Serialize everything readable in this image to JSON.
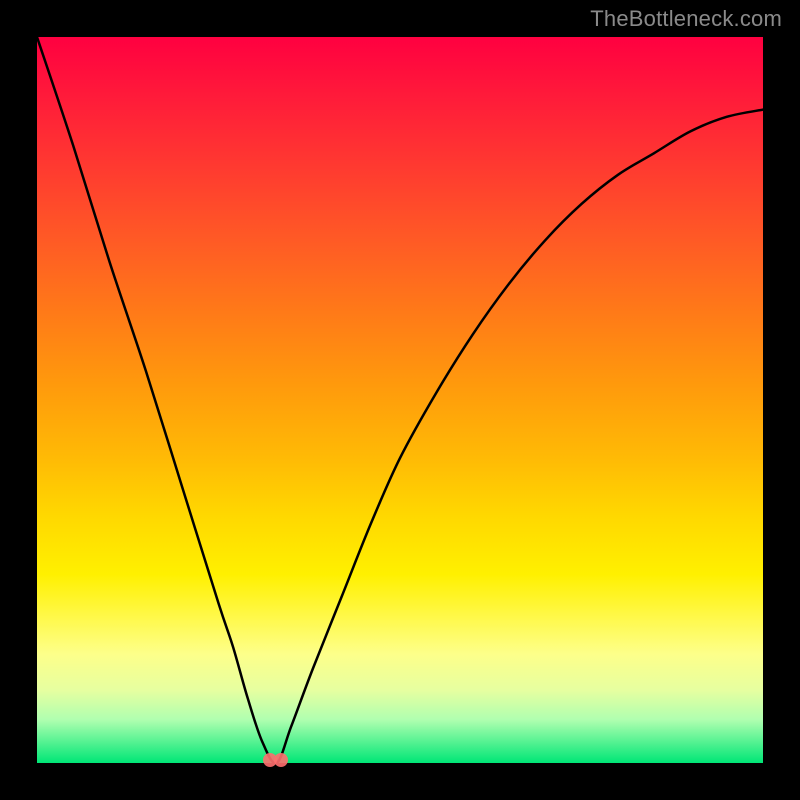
{
  "watermark": "TheBottleneck.com",
  "colors": {
    "bg": "#000000",
    "curve": "#000000",
    "dot": "#ff6e6e",
    "gradient_top": "#ff0040",
    "gradient_bottom": "#00e676"
  },
  "chart_data": {
    "type": "line",
    "title": "",
    "xlabel": "",
    "ylabel": "",
    "xlim": [
      0,
      100
    ],
    "ylim": [
      0,
      100
    ],
    "grid": false,
    "legend": false,
    "series": [
      {
        "name": "bottleneck-curve",
        "x": [
          0,
          5,
          10,
          15,
          20,
          25,
          27,
          29,
          31,
          33,
          35,
          38,
          42,
          46,
          50,
          55,
          60,
          65,
          70,
          75,
          80,
          85,
          90,
          95,
          100
        ],
        "y": [
          100,
          85,
          69,
          54,
          38,
          22,
          16,
          9,
          3,
          0,
          5,
          13,
          23,
          33,
          42,
          51,
          59,
          66,
          72,
          77,
          81,
          84,
          87,
          89,
          90
        ]
      }
    ],
    "annotations": [
      {
        "name": "min-marker-1",
        "x": 32.1,
        "y": 0.4
      },
      {
        "name": "min-marker-2",
        "x": 33.6,
        "y": 0.4
      }
    ]
  }
}
